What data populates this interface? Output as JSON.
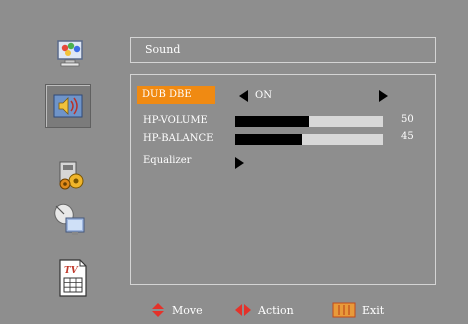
{
  "window": {
    "title": "Sound"
  },
  "sidebar": {
    "items": [
      {
        "name": "picture-icon"
      },
      {
        "name": "sound-icon",
        "selected": true
      },
      {
        "name": "setup-icon"
      },
      {
        "name": "satellite-channel-icon"
      },
      {
        "name": "teletext-icon",
        "glyph": "TV"
      }
    ]
  },
  "menu": {
    "items": [
      {
        "label": "DUB DBE",
        "type": "option",
        "value": "ON",
        "selected": true
      },
      {
        "label": "HP-VOLUME",
        "type": "slider",
        "value": 50,
        "max": 100
      },
      {
        "label": "HP-BALANCE",
        "type": "slider",
        "value": 45,
        "max": 100
      },
      {
        "label": "Equalizer",
        "type": "submenu"
      }
    ]
  },
  "footer": {
    "move_label": "Move",
    "action_label": "Action",
    "exit_label": "Exit"
  },
  "colors": {
    "background": "#8e8e8e",
    "highlight": "#f08a12",
    "bar_fill": "#000000",
    "bar_track": "#d8d8d8"
  }
}
